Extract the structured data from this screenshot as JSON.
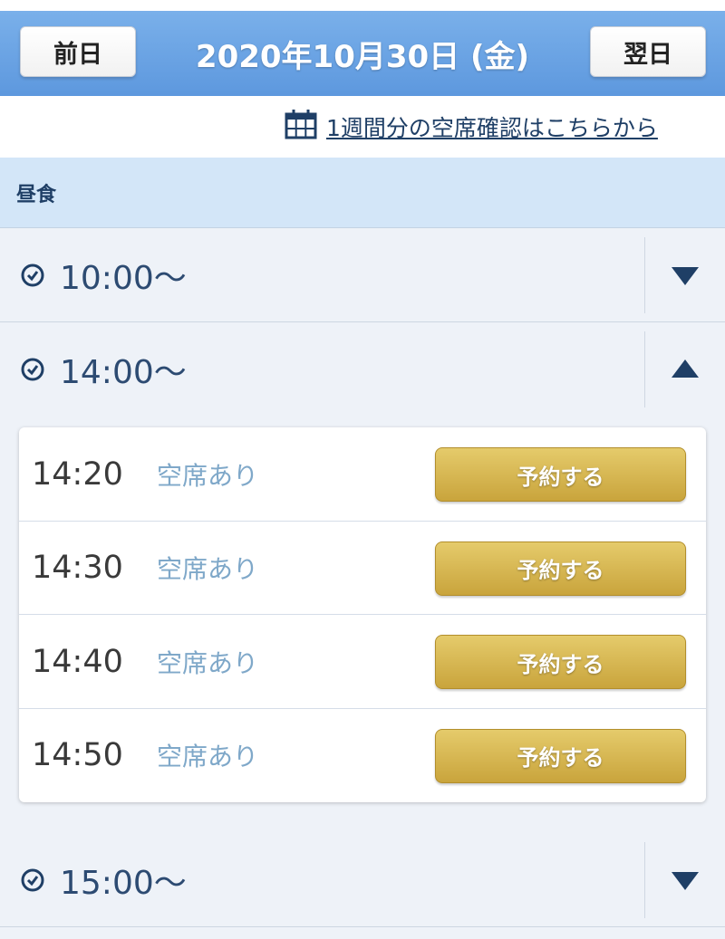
{
  "date_nav": {
    "prev_label": "前日",
    "date": "2020年10月30日 (金)",
    "next_label": "翌日"
  },
  "week_link": {
    "text": "1週間分の空席確認はこちらから"
  },
  "meal": {
    "label": "昼食"
  },
  "slots": [
    {
      "label": "10:00〜",
      "expanded": false
    },
    {
      "label": "14:00〜",
      "expanded": true
    },
    {
      "label": "15:00〜",
      "expanded": false
    }
  ],
  "times": [
    {
      "time": "14:20",
      "status": "空席あり",
      "action": "予約する"
    },
    {
      "time": "14:30",
      "status": "空席あり",
      "action": "予約する"
    },
    {
      "time": "14:40",
      "status": "空席あり",
      "action": "予約する"
    },
    {
      "time": "14:50",
      "status": "空席あり",
      "action": "予約する"
    }
  ],
  "colors": {
    "nav_blue": "#6aa4e4",
    "text_navy": "#1f3f66",
    "gold_button": "#d4b552",
    "availability_text": "#7fa8c9"
  }
}
